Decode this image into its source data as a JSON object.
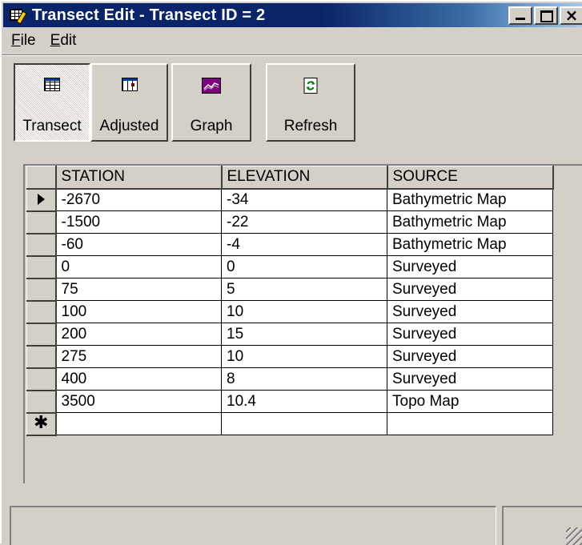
{
  "window": {
    "title": "Transect Edit - Transect ID = 2",
    "controls": {
      "close": "×"
    }
  },
  "menu": [
    {
      "label": "File",
      "accel": "F",
      "rest": "ile"
    },
    {
      "label": "Edit",
      "accel": "E",
      "rest": "dit"
    }
  ],
  "toolbar": {
    "transect": {
      "label": "Transect",
      "icon": "table-icon"
    },
    "adjusted": {
      "label": "Adjusted",
      "icon": "adjusted-table-icon"
    },
    "graph": {
      "label": "Graph",
      "icon": "graph-icon"
    },
    "refresh": {
      "label": "Refresh",
      "icon": "refresh-icon"
    }
  },
  "grid": {
    "columns": [
      "STATION",
      "ELEVATION",
      "SOURCE"
    ],
    "rows": [
      [
        "-2670",
        "-34",
        "Bathymetric Map"
      ],
      [
        "-1500",
        "-22",
        "Bathymetric Map"
      ],
      [
        "-60",
        "-4",
        "Bathymetric Map"
      ],
      [
        "0",
        "0",
        "Surveyed"
      ],
      [
        "75",
        "5",
        "Surveyed"
      ],
      [
        "100",
        "10",
        "Surveyed"
      ],
      [
        "200",
        "15",
        "Surveyed"
      ],
      [
        "275",
        "10",
        "Surveyed"
      ],
      [
        "400",
        "8",
        "Surveyed"
      ],
      [
        "3500",
        "10.4",
        "Topo Map"
      ]
    ],
    "current_row_marker": "arrow",
    "new_row_marker": "✱"
  },
  "colors": {
    "titlebar": "#0a246a",
    "face": "#d4d0c8"
  }
}
